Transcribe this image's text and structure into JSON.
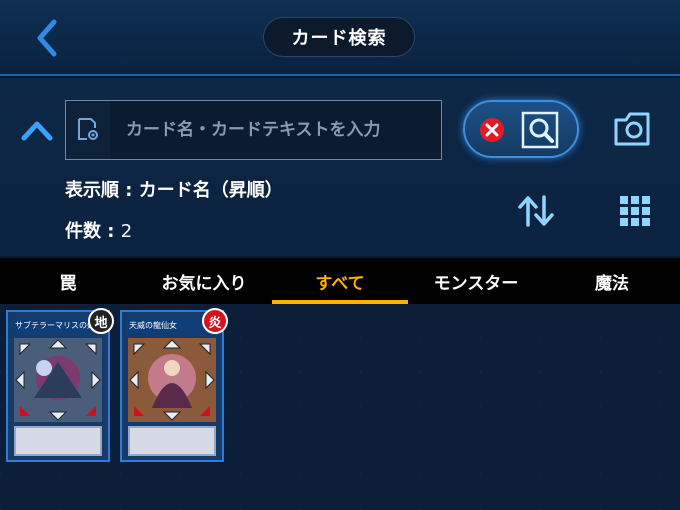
{
  "header": {
    "title": "カード検索"
  },
  "search": {
    "placeholder": "カード名・カードテキストを入力",
    "value": ""
  },
  "sort": {
    "label": "表示順 : カード名（昇順）"
  },
  "count": {
    "label": "件数 : ",
    "value": "2"
  },
  "tabs": [
    {
      "label": "罠",
      "active": false
    },
    {
      "label": "お気に入り",
      "active": false
    },
    {
      "label": "すべて",
      "active": true
    },
    {
      "label": "モンスター",
      "active": false
    },
    {
      "label": "魔法",
      "active": false
    }
  ],
  "cards": [
    {
      "name": "サブテラーマリスの妖女",
      "attribute": "地",
      "attr_color": "#222222"
    },
    {
      "name": "天威の龍仙女",
      "attribute": "炎",
      "attr_color": "#d4141c"
    }
  ],
  "colors": {
    "accent": "#ffb000",
    "panel": "#0d2846",
    "glow": "#3f8fd8"
  }
}
